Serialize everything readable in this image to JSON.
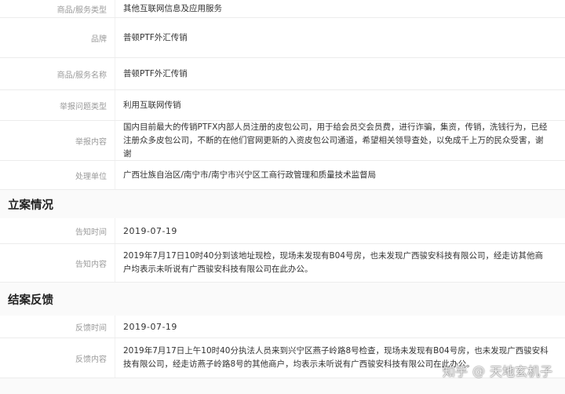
{
  "report": {
    "rows": [
      {
        "label": "商品/服务类型",
        "value": "其他互联网信息及应用服务"
      },
      {
        "label": "品牌",
        "value": "普顿PTF外汇传销"
      },
      {
        "label": "商品/服务名称",
        "value": "普顿PTF外汇传销"
      },
      {
        "label": "举报问题类型",
        "value": "利用互联网传销"
      },
      {
        "label": "举报内容",
        "value": "国内目前最大的传销PTFX内部人员注册的皮包公司，用于给会员交会员费，进行诈骗，集资，传销，洗钱行为，已经注册众多皮包公司，不断的在他们官网更新的入资皮包公司通道，希望相关领导查处，以免成千上万的民众受害，谢谢"
      },
      {
        "label": "处理单位",
        "value": "广西壮族自治区/南宁市/南宁市兴宁区工商行政管理和质量技术监督局"
      }
    ]
  },
  "filing": {
    "title": "立案情况",
    "rows": [
      {
        "label": "告知时间",
        "value": "2019-07-19"
      },
      {
        "label": "告知内容",
        "value": "2019年7月17日10时40分到该地址现检，现场未发现有B04号房，也未发现广西骏安科技有限公司，经走访其他商户均表示未听说有广西骏安科技有限公司在此办公。"
      }
    ]
  },
  "closing": {
    "title": "结案反馈",
    "rows": [
      {
        "label": "反馈时间",
        "value": "2019-07-19"
      },
      {
        "label": "反馈内容",
        "value": "2019年7月17日上午10时40分执法人员来到兴宁区燕子岭路8号检查，现场未发现有B04号房，也未发现广西骏安科技有限公司，经走访燕子岭路8号的其他商户，均表示未听说有广西骏安科技有限公司在此办公。"
      }
    ]
  },
  "watermark": {
    "site": "知乎",
    "separator": "@",
    "author": "天地玄机子"
  }
}
